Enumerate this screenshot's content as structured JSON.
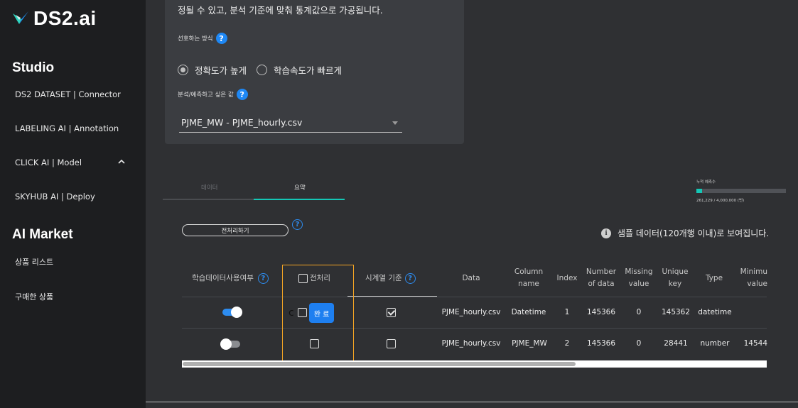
{
  "sidebar": {
    "logo_text": "DS2.ai",
    "studio_title": "Studio",
    "items": [
      {
        "label": "DS2 DATASET | Connector"
      },
      {
        "label": "LABELING AI | Annotation"
      },
      {
        "label": "CLICK AI | Model"
      },
      {
        "label": "SKYHUB AI | Deploy"
      }
    ],
    "market_title": "AI Market",
    "market_items": [
      {
        "label": "상품 리스트"
      },
      {
        "label": "구매한 상품"
      }
    ]
  },
  "card": {
    "description": "정될 수 있고, 분석 기준에 맞춰 통계값으로 가공됩니다.",
    "method_label": "선호하는 방식",
    "radio_accuracy": "정확도가 높게",
    "radio_speed": "학습속도가 빠르게",
    "target_label": "분석/예측하고 싶은 값",
    "target_value": "PJME_MW - PJME_hourly.csv",
    "help_glyph": "?"
  },
  "tabs": {
    "data": "데이터",
    "summary": "요약"
  },
  "quota": {
    "label": "누적 예측수",
    "text": "261,229 / 4,000,000 (번)",
    "fraction": 0.065
  },
  "preprocess_button": "전처리하기",
  "sample_note": "샘플 데이터(120개행 이내)로 보여집니다.",
  "table": {
    "headers": {
      "use": "학습데이터사용여부",
      "preprocess": "전처리",
      "timeseries": "시계열 기준",
      "data": "Data",
      "column_name": "Column\nname",
      "index": "Index",
      "number_of_data": "Number\nof data",
      "missing": "Missing\nvalue",
      "unique": "Unique\nkey",
      "type": "Type",
      "minimum": "Minimu\nvalue"
    },
    "rows": [
      {
        "use": true,
        "preprocess_checked": false,
        "timeseries_checked": true,
        "data": "PJME_hourly.csv",
        "column_name": "Datetime",
        "index": "1",
        "number_of_data": "145366",
        "missing": "0",
        "unique": "145362",
        "type": "datetime",
        "minimum": ""
      },
      {
        "use": false,
        "preprocess_checked": false,
        "timeseries_checked": false,
        "data": "PJME_hourly.csv",
        "column_name": "PJME_MW",
        "index": "2",
        "number_of_data": "145366",
        "missing": "0",
        "unique": "28441",
        "type": "number",
        "minimum": "14544"
      }
    ],
    "done_button": "완 료"
  },
  "colors": {
    "accent": "#1e88f5",
    "teal": "#14c7b6",
    "highlight_frame": "#f5a524"
  }
}
